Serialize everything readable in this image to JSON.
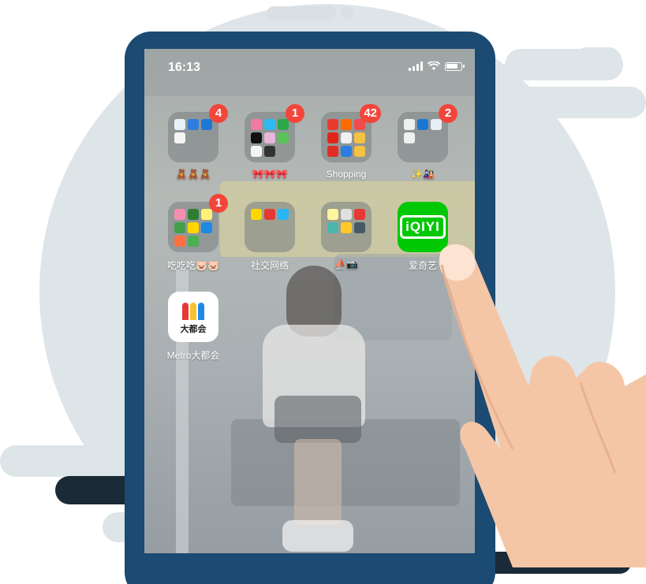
{
  "status_bar": {
    "time": "16:13"
  },
  "home_screen": {
    "row1": [
      {
        "label": "🧸🧸🧸",
        "badge": "4",
        "mini_icons": [
          "map-pin-icon",
          "plane-icon",
          "ring-app-icon",
          "calendar-app-icon"
        ],
        "mini_colors": [
          "#e8f2fb",
          "#2f7de1",
          "#1e78d6",
          "#f5f5f5"
        ]
      },
      {
        "label": "🎀🎀🎀",
        "badge": "1",
        "mini_icons": [
          "game-app-icon",
          "tv-app-icon",
          "play-app-icon",
          "tiktok-icon",
          "bubble-app-icon",
          "green-app-icon",
          "weibo-icon",
          "k-app-icon"
        ],
        "mini_colors": [
          "#f07aa0",
          "#2dbaf0",
          "#2ba84a",
          "#111111",
          "#e8b6d8",
          "#5ac05a",
          "#f5f5f5",
          "#333333"
        ]
      },
      {
        "label": "Shopping",
        "badge": "42",
        "mini_icons": [
          "tmall-icon",
          "taobao-icon",
          "red-app-icon",
          "jd-icon",
          "vip-icon",
          "deal-app-icon",
          "pdd-icon",
          "blue-app-icon",
          "ele-icon"
        ],
        "mini_colors": [
          "#e93a2e",
          "#ff6a00",
          "#f24a4a",
          "#e2231a",
          "#f0f0f0",
          "#f5c242",
          "#e02e24",
          "#2b7de0",
          "#f5c242"
        ]
      },
      {
        "label": "✨🎎",
        "badge": "2",
        "mini_icons": [
          "bank-app-icon",
          "c-app-icon",
          "loop-app-icon",
          "mobile-app-icon"
        ],
        "mini_colors": [
          "#f0f0f0",
          "#1a76d2",
          "#e8eef5",
          "#f0f0f0"
        ]
      }
    ],
    "row2": [
      {
        "label": "吃吃吃🐷🐷",
        "badge": "1",
        "mini_icons": [
          "pink-app-icon",
          "red-leaf-icon",
          "yellow-app-icon",
          "green-app-icon",
          "meituan-icon",
          "blue-app-icon",
          "orange-app-icon",
          "green-round-icon"
        ],
        "mini_colors": [
          "#f48fb1",
          "#2e7d32",
          "#fff176",
          "#43a047",
          "#ffd600",
          "#1e88e5",
          "#ff7043",
          "#4caf50"
        ]
      },
      {
        "label": "社交网络",
        "badge": "",
        "mini_icons": [
          "yellow-chat-icon",
          "red-app-icon",
          "blue-app-icon"
        ],
        "mini_colors": [
          "#ffd600",
          "#e53935",
          "#29b6f6"
        ]
      },
      {
        "label": "⛵📷",
        "badge": "",
        "mini_icons": [
          "notes-icon",
          "camera-app-icon",
          "music-app-icon",
          "face-app-icon",
          "photos-icon",
          "dark-app-icon"
        ],
        "mini_colors": [
          "#fff59d",
          "#e0e0e0",
          "#e53935",
          "#4db6ac",
          "#ffca28",
          "#455a64"
        ]
      },
      {
        "label": "爱奇艺",
        "badge": "",
        "icon_text": "iQIYI",
        "color": "#00c805"
      }
    ],
    "row3": [
      {
        "label": "Metro大都会",
        "badge": "",
        "icon_text": "大都会",
        "bar_colors": [
          "#e53935",
          "#fbc02d",
          "#1e88e5"
        ]
      }
    ]
  },
  "colors": {
    "phone_frame": "#1b4a72",
    "background_circle": "#dde5e8",
    "badge": "#f2463b",
    "skin": "#f5c6a5"
  }
}
